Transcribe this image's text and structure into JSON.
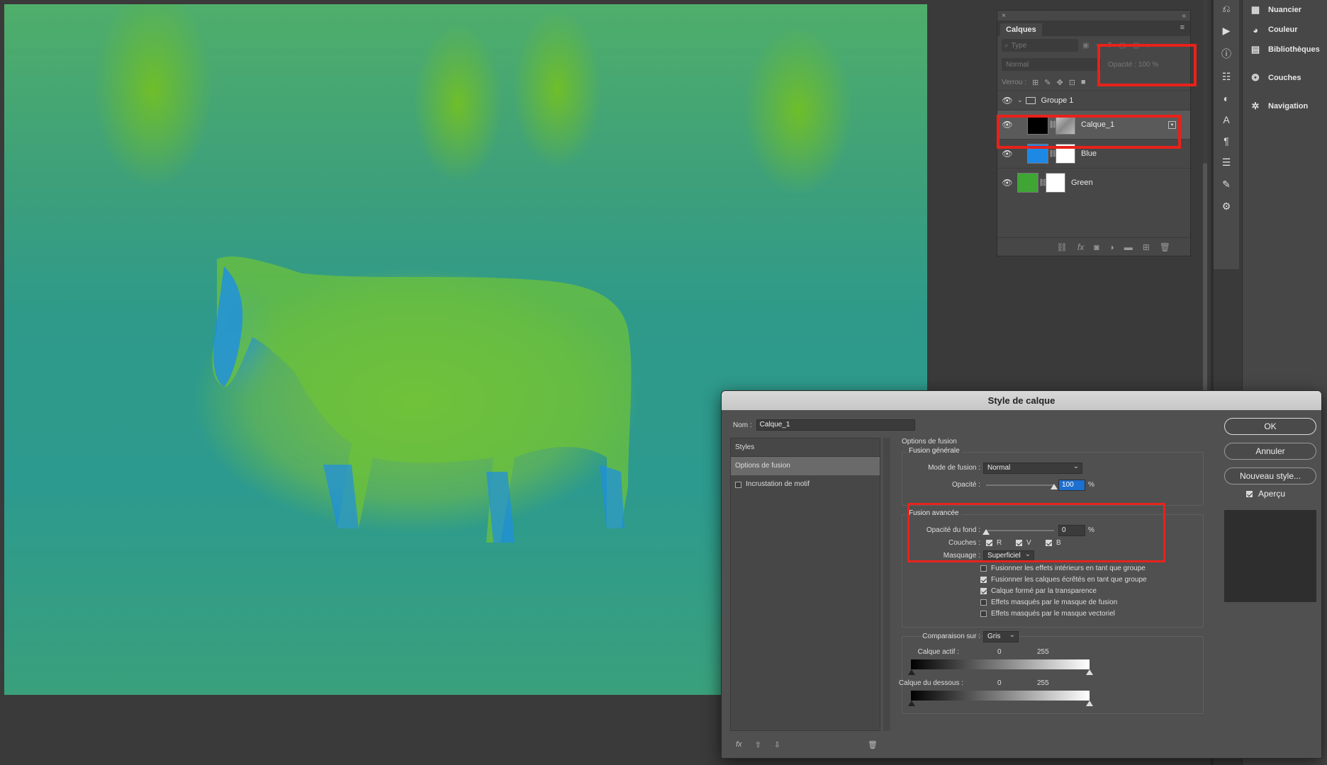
{
  "layers_panel": {
    "tab": "Calques",
    "filter_placeholder": "Type",
    "blend_mode": "Normal",
    "opacity_label": "Opacité :",
    "opacity_value": "100 %",
    "lock_label": "Verrou :",
    "layers": [
      {
        "name": "Groupe 1",
        "kind": "group"
      },
      {
        "name": "Calque_1",
        "kind": "layer",
        "selected": true,
        "thumb_color": "#000000"
      },
      {
        "name": "Blue",
        "kind": "layer",
        "thumb_color": "#1e88e5"
      },
      {
        "name": "Green",
        "kind": "layer",
        "thumb_color": "#3fa535"
      }
    ]
  },
  "side_panels": [
    {
      "label": "Nuancier",
      "icon": "grid-icon"
    },
    {
      "label": "Couleur",
      "icon": "palette-icon"
    },
    {
      "label": "Bibliothèques",
      "icon": "library-icon"
    },
    {
      "label": "Couches",
      "icon": "channels-icon"
    },
    {
      "label": "Navigation",
      "icon": "navigator-icon"
    }
  ],
  "dialog": {
    "title": "Style de calque",
    "name_label": "Nom :",
    "name_value": "Calque_1",
    "styles_header": "Styles",
    "styles_items": [
      {
        "label": "Options de fusion",
        "active": true
      },
      {
        "label": "Incrustation de motif",
        "active": false,
        "checked": false
      }
    ],
    "section_title": "Options de fusion",
    "general": {
      "legend": "Fusion générale",
      "mode_label": "Mode de fusion :",
      "mode_value": "Normal",
      "opacity_label": "Opacité :",
      "opacity_value": "100",
      "opacity_fraction": 1.0,
      "pct": "%"
    },
    "advanced": {
      "legend": "Fusion avancée",
      "fill_label": "Opacité du fond :",
      "fill_value": "0",
      "fill_fraction": 0.0,
      "pct": "%",
      "channels_label": "Couches :",
      "channels": [
        {
          "label": "R",
          "checked": true
        },
        {
          "label": "V",
          "checked": true
        },
        {
          "label": "B",
          "checked": true
        }
      ],
      "knockout_label": "Masquage :",
      "knockout_value": "Superficiel",
      "options": [
        {
          "label": "Fusionner les effets intérieurs en tant que groupe",
          "checked": false
        },
        {
          "label": "Fusionner les calques écrêtés en tant que groupe",
          "checked": true
        },
        {
          "label": "Calque formé par la transparence",
          "checked": true
        },
        {
          "label": "Effets masqués par le masque de fusion",
          "checked": false
        },
        {
          "label": "Effets masqués par le masque vectoriel",
          "checked": false
        }
      ]
    },
    "blend_if": {
      "label": "Comparaison sur :",
      "value": "Gris",
      "this_layer_label": "Calque actif :",
      "this_layer_min": "0",
      "this_layer_max": "255",
      "under_layer_label": "Calque du dessous :",
      "under_layer_min": "0",
      "under_layer_max": "255"
    },
    "buttons": {
      "ok": "OK",
      "cancel": "Annuler",
      "new_style": "Nouveau style...",
      "preview": "Aperçu",
      "preview_checked": true
    }
  }
}
